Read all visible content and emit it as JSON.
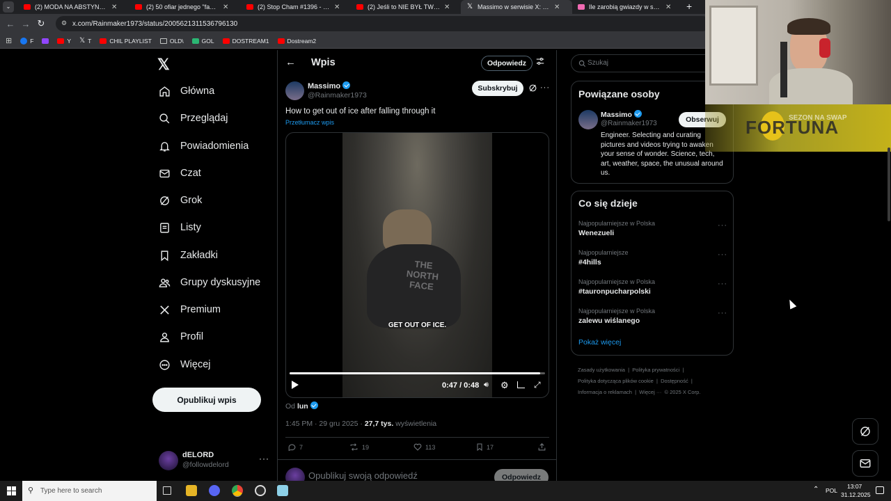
{
  "browser": {
    "tabs": [
      {
        "title": "(2) MODA NA ABSTYNENCJĘ?",
        "icon": "youtube-icon"
      },
      {
        "title": "(2) 50 ofiar jednego \"fachowca\"",
        "icon": "youtube-icon"
      },
      {
        "title": "(2) Stop Cham #1396 - Niebezp",
        "icon": "youtube-icon"
      },
      {
        "title": "(2) Jeśli to NIE BYŁ TWÓJ ROK",
        "icon": "youtube-icon"
      },
      {
        "title": "Massimo w serwisie X: „How to",
        "icon": "x-icon",
        "active": true
      },
      {
        "title": "Ile zarobią gwiazdy w sylwestra",
        "icon": "pink-icon"
      }
    ],
    "url": "x.com/Rainmaker1973/status/2005621311536796130",
    "bookmarks": [
      {
        "label": "F",
        "icon": "facebook-icon"
      },
      {
        "label": "",
        "icon": "twitch-icon"
      },
      {
        "label": "Y",
        "icon": "youtube-icon"
      },
      {
        "label": "T",
        "icon": "x-icon"
      },
      {
        "label": "CHIL PLAYLIST",
        "icon": "youtube-icon"
      },
      {
        "label": "OLD\\",
        "icon": "folder-icon"
      },
      {
        "label": "GOL",
        "icon": "gol-icon"
      },
      {
        "label": "DOSTREAM1",
        "icon": "youtube-icon"
      },
      {
        "label": "Dostream2",
        "icon": "youtube-icon"
      }
    ]
  },
  "nav": {
    "items": [
      {
        "label": "Główna",
        "icon": "home-icon"
      },
      {
        "label": "Przeglądaj",
        "icon": "search-icon"
      },
      {
        "label": "Powiadomienia",
        "icon": "bell-icon"
      },
      {
        "label": "Czat",
        "icon": "mail-icon"
      },
      {
        "label": "Grok",
        "icon": "grok-icon"
      },
      {
        "label": "Listy",
        "icon": "list-icon"
      },
      {
        "label": "Zakładki",
        "icon": "bookmark-icon"
      },
      {
        "label": "Grupy dyskusyjne",
        "icon": "people-icon"
      },
      {
        "label": "Premium",
        "icon": "x-icon"
      },
      {
        "label": "Profil",
        "icon": "user-icon"
      },
      {
        "label": "Więcej",
        "icon": "more-circle-icon"
      }
    ],
    "post_button": "Opublikuj wpis",
    "account": {
      "name": "dELORD",
      "handle": "@followdelord"
    }
  },
  "post": {
    "header_title": "Wpis",
    "reply_button": "Odpowiedz",
    "author_name": "Massimo",
    "author_handle": "@Rainmaker1973",
    "subscribe_button": "Subskrybuj",
    "text": "How to get out of ice after falling through it",
    "translate_link": "Przetłumacz wpis",
    "video": {
      "caption": "GET OUT OF ICE.",
      "shirt_text": "THE NORTH FACE",
      "time": "0:47 / 0:48",
      "progress": 0.98
    },
    "from_label": "Od",
    "from_user": "lun",
    "timestamp": "1:45 PM · 29 gru 2025 · ",
    "views_count": "27,7 tys.",
    "views_label": " wyświetlenia",
    "stats": {
      "replies": "7",
      "reposts": "19",
      "likes": "113",
      "bookmarks": "17"
    },
    "reply_placeholder": "Opublikuj swoją odpowiedź",
    "reply_submit": "Odpowiedz"
  },
  "sidebar": {
    "search_placeholder": "Szukaj",
    "related_title": "Powiązane osoby",
    "related": {
      "name": "Massimo",
      "handle": "@Rainmaker1973",
      "follow_button": "Obserwuj",
      "bio": "Engineer. Selecting and curating pictures and videos trying to awaken your sense of wonder. Science, tech, art, weather, space, the unusual around us."
    },
    "trending_title": "Co się dzieje",
    "trends": [
      {
        "context": "Najpopularniejsze w Polska",
        "name": "Wenezueli"
      },
      {
        "context": "Najpopularniejsze",
        "name": "#4hills"
      },
      {
        "context": "Najpopularniejsze w Polska",
        "name": "#tauronpucharpolski"
      },
      {
        "context": "Najpopularniejsze w Polska",
        "name": "zalewu wiślanego"
      }
    ],
    "show_more": "Pokaż więcej",
    "footer": [
      "Zasady użytkowania",
      "|",
      "Polityka prywatności",
      "|",
      "Polityka dotycząca plików cookie",
      "|",
      "Dostępność",
      "|",
      "Informacja o reklamach",
      "|",
      "Więcej ···",
      "© 2025 X Corp."
    ]
  },
  "overlay": {
    "logo_text": "FORTUNA",
    "logo_subtext": "SEZON NA SWAP"
  },
  "taskbar": {
    "search_placeholder": "Type here to search",
    "language": "POL",
    "time": "13:07",
    "date": "31.12.2025"
  },
  "colors": {
    "accent": "#1d9bf0",
    "background": "#000000",
    "border": "#2f3336",
    "muted": "#71767b"
  }
}
